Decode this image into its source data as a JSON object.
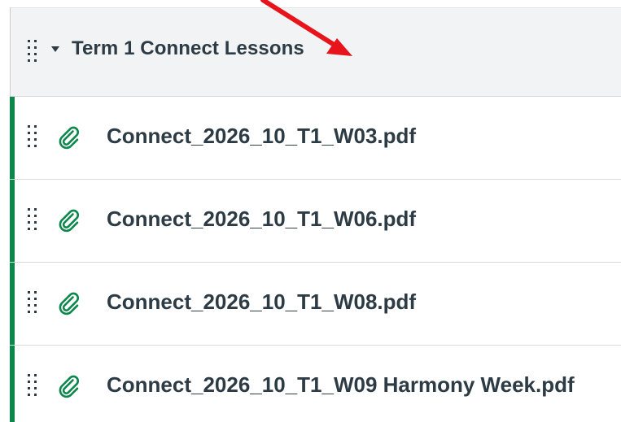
{
  "module": {
    "title": "Term 1 Connect Lessons",
    "items": [
      {
        "title": "Connect_2026_10_T1_W03.pdf",
        "icon": "attachment-icon"
      },
      {
        "title": "Connect_2026_10_T1_W06.pdf",
        "icon": "attachment-icon"
      },
      {
        "title": "Connect_2026_10_T1_W08.pdf",
        "icon": "attachment-icon"
      },
      {
        "title": "Connect_2026_10_T1_W09 Harmony Week.pdf",
        "icon": "attachment-icon"
      }
    ]
  },
  "colors": {
    "header_bg": "#f2f3f4",
    "text": "#2d3b45",
    "published_bar": "#0b874b",
    "attachment_icon": "#0b874b",
    "annotation_arrow": "#e8141b"
  }
}
